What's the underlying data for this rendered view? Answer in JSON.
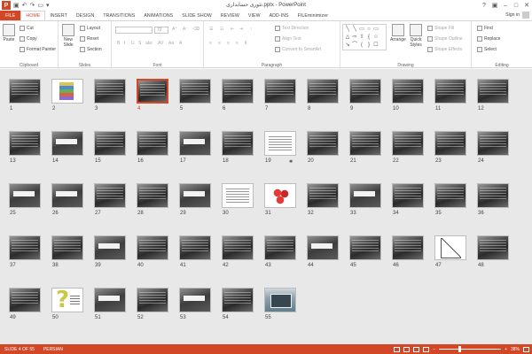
{
  "window": {
    "title": "تئوری حسابداری.pptx - PowerPoint",
    "app_icon": "P",
    "controls": [
      "?",
      "▣",
      "–",
      "□",
      "✕"
    ]
  },
  "qat": {
    "icons": [
      "save-icon",
      "undo-icon",
      "redo-icon",
      "start-slideshow-icon",
      "customize-qat-icon"
    ]
  },
  "ribbon_tabs": [
    "FILE",
    "HOME",
    "INSERT",
    "DESIGN",
    "TRANSITIONS",
    "ANIMATIONS",
    "SLIDE SHOW",
    "REVIEW",
    "VIEW",
    "ADD-INS",
    "FILEminimizer"
  ],
  "active_tab": "HOME",
  "account": {
    "signin": "Sign in"
  },
  "ribbon": {
    "clipboard": {
      "paste": "Paste",
      "cut": "Cut",
      "copy": "Copy",
      "format_painter": "Format Painter",
      "label": "Clipboard"
    },
    "slides": {
      "new_slide": "New",
      "new_slide2": "Slide",
      "layout": "Layout",
      "reset": "Reset",
      "section": "Section",
      "label": "Slides"
    },
    "font": {
      "size": "72",
      "label": "Font"
    },
    "paragraph": {
      "text_direction": "Text Direction",
      "align_text": "Align Text",
      "convert_smartart": "Convert to SmartArt",
      "label": "Paragraph"
    },
    "drawing": {
      "arrange": "Arrange",
      "quick_styles": "Quick",
      "quick_styles2": "Styles",
      "shape_fill": "Shape Fill",
      "shape_outline": "Shape Outline",
      "shape_effects": "Shape Effects",
      "label": "Drawing"
    },
    "editing": {
      "find": "Find",
      "replace": "Replace",
      "select": "Select",
      "label": "Editing"
    }
  },
  "slides": [
    {
      "n": "1",
      "type": "dark"
    },
    {
      "n": "2",
      "type": "colors"
    },
    {
      "n": "3",
      "type": "dark"
    },
    {
      "n": "4",
      "type": "dark"
    },
    {
      "n": "5",
      "type": "dark"
    },
    {
      "n": "6",
      "type": "dark"
    },
    {
      "n": "7",
      "type": "dark"
    },
    {
      "n": "8",
      "type": "dark"
    },
    {
      "n": "9",
      "type": "dark"
    },
    {
      "n": "10",
      "type": "dark"
    },
    {
      "n": "11",
      "type": "dark"
    },
    {
      "n": "12",
      "type": "dark"
    },
    {
      "n": "13",
      "type": "dark"
    },
    {
      "n": "14",
      "type": "banner"
    },
    {
      "n": "15",
      "type": "dark"
    },
    {
      "n": "16",
      "type": "dark"
    },
    {
      "n": "17",
      "type": "banner"
    },
    {
      "n": "18",
      "type": "dark"
    },
    {
      "n": "19",
      "type": "white"
    },
    {
      "n": "20",
      "type": "dark"
    },
    {
      "n": "21",
      "type": "dark"
    },
    {
      "n": "22",
      "type": "dark"
    },
    {
      "n": "23",
      "type": "dark"
    },
    {
      "n": "24",
      "type": "dark"
    },
    {
      "n": "25",
      "type": "banner"
    },
    {
      "n": "26",
      "type": "banner"
    },
    {
      "n": "27",
      "type": "dark"
    },
    {
      "n": "28",
      "type": "dark"
    },
    {
      "n": "29",
      "type": "banner"
    },
    {
      "n": "30",
      "type": "white"
    },
    {
      "n": "31",
      "type": "red"
    },
    {
      "n": "32",
      "type": "dark"
    },
    {
      "n": "33",
      "type": "banner"
    },
    {
      "n": "34",
      "type": "dark"
    },
    {
      "n": "35",
      "type": "dark"
    },
    {
      "n": "36",
      "type": "dark"
    },
    {
      "n": "37",
      "type": "dark"
    },
    {
      "n": "38",
      "type": "dark"
    },
    {
      "n": "39",
      "type": "banner"
    },
    {
      "n": "40",
      "type": "dark"
    },
    {
      "n": "41",
      "type": "dark"
    },
    {
      "n": "42",
      "type": "dark"
    },
    {
      "n": "43",
      "type": "dark"
    },
    {
      "n": "44",
      "type": "banner"
    },
    {
      "n": "45",
      "type": "dark"
    },
    {
      "n": "46",
      "type": "dark"
    },
    {
      "n": "47",
      "type": "diagram"
    },
    {
      "n": "48",
      "type": "dark"
    },
    {
      "n": "49",
      "type": "dark"
    },
    {
      "n": "50",
      "type": "question"
    },
    {
      "n": "51",
      "type": "banner"
    },
    {
      "n": "52",
      "type": "dark"
    },
    {
      "n": "53",
      "type": "banner"
    },
    {
      "n": "54",
      "type": "dark"
    },
    {
      "n": "55",
      "type": "photo"
    }
  ],
  "selected_slide": "4",
  "star_slide": "19",
  "star_glyph": "✱",
  "status": {
    "slide_info": "SLIDE 4 OF 55",
    "language": "PERSIAN",
    "zoom": "38%"
  },
  "colors": {
    "accent": "#d24726"
  }
}
